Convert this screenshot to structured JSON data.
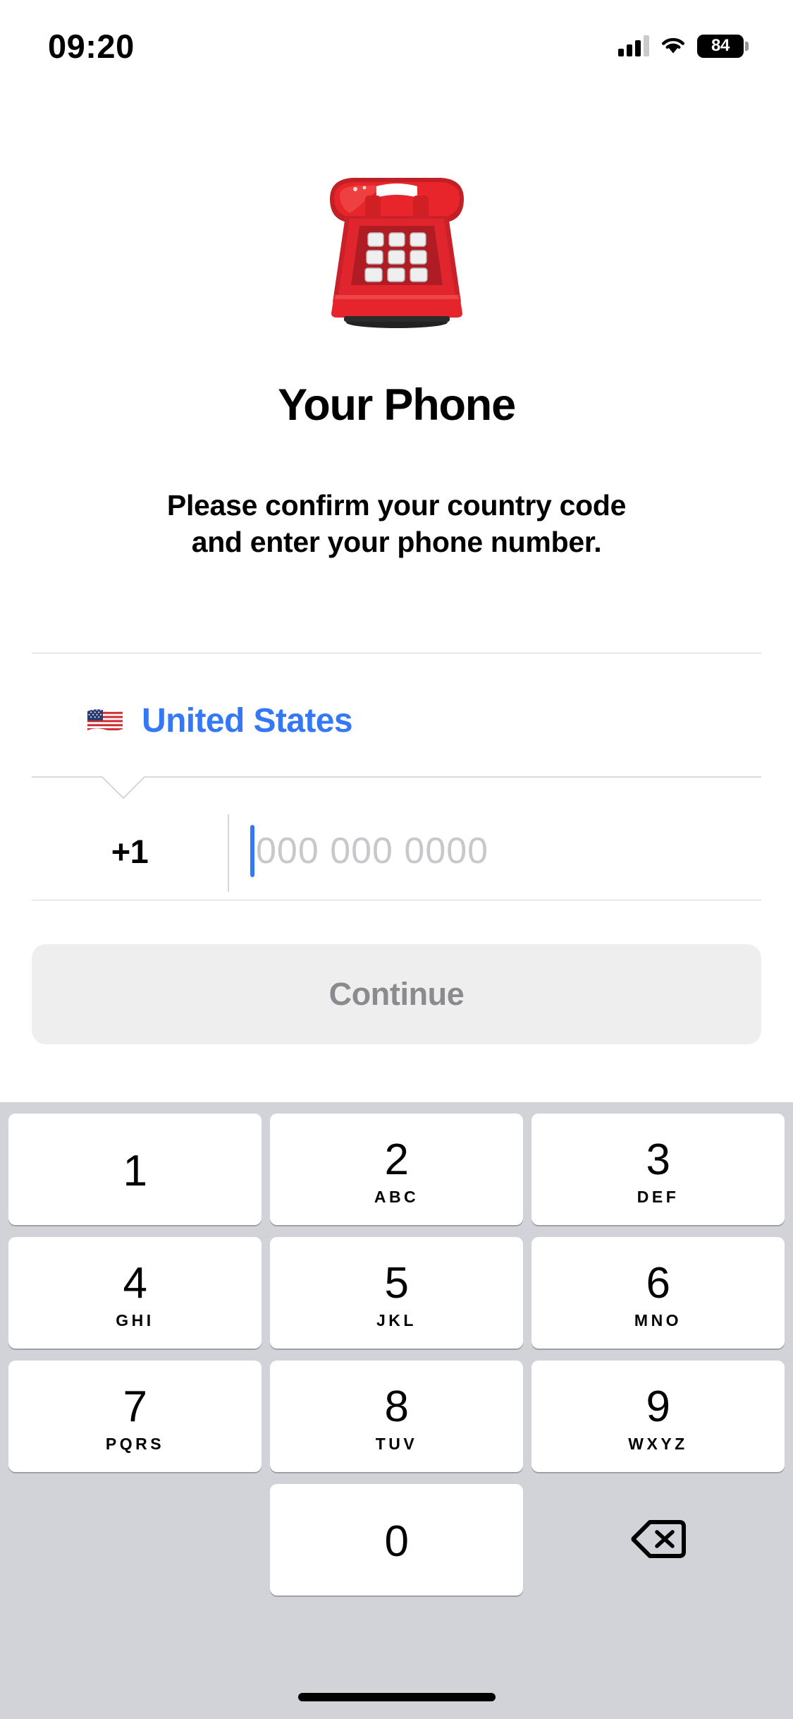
{
  "status_bar": {
    "time": "09:20",
    "battery_level": "84",
    "signal_icon": "cellular-signal-icon",
    "wifi_icon": "wifi-icon",
    "battery_icon": "battery-icon"
  },
  "hero": {
    "emoji_name": "telephone-emoji",
    "emoji_char": "☎️"
  },
  "content": {
    "title": "Your Phone",
    "subtitle_line_1": "Please confirm your country code",
    "subtitle_line_2": "and enter your phone number."
  },
  "country_selector": {
    "flag_name": "flag-united-states-emoji",
    "flag_char": "🇺🇸",
    "country_name": "United States",
    "accent_color": "#3478F6"
  },
  "phone_input": {
    "dial_code": "+1",
    "placeholder": "000 000 0000",
    "value": "",
    "caret_color": "#3478F6",
    "placeholder_color": "#C7C7CC"
  },
  "continue_button": {
    "label": "Continue",
    "enabled": false,
    "background_color": "#EEEEEE",
    "text_color": "#8A8A8F"
  },
  "keypad": {
    "background_color": "#D1D3D9",
    "keys": [
      {
        "num": "1",
        "letters": ""
      },
      {
        "num": "2",
        "letters": "ABC"
      },
      {
        "num": "3",
        "letters": "DEF"
      },
      {
        "num": "4",
        "letters": "GHI"
      },
      {
        "num": "5",
        "letters": "JKL"
      },
      {
        "num": "6",
        "letters": "MNO"
      },
      {
        "num": "7",
        "letters": "PQRS"
      },
      {
        "num": "8",
        "letters": "TUV"
      },
      {
        "num": "9",
        "letters": "WXYZ"
      },
      {
        "num": "0",
        "letters": ""
      }
    ],
    "delete_icon": "backspace-delete-icon"
  },
  "home_indicator": {
    "name": "home-indicator"
  }
}
